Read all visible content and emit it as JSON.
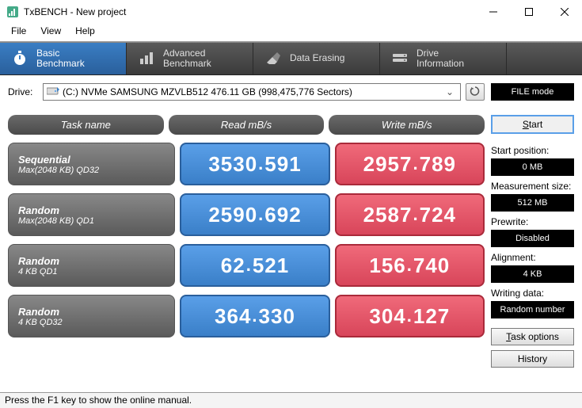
{
  "window": {
    "title": "TxBENCH - New project"
  },
  "menu": {
    "file": "File",
    "view": "View",
    "help": "Help"
  },
  "tabs": {
    "basic": "Basic\nBenchmark",
    "advanced": "Advanced\nBenchmark",
    "erasing": "Data Erasing",
    "driveinfo": "Drive\nInformation"
  },
  "drive": {
    "label": "Drive:",
    "value": "(C:) NVMe SAMSUNG MZVLB512  476.11 GB (998,475,776 Sectors)"
  },
  "headers": {
    "task": "Task name",
    "read": "Read mB/s",
    "write": "Write mB/s"
  },
  "rows": [
    {
      "title": "Sequential",
      "sub": "Max(2048 KB) QD32",
      "read": "3530.591",
      "write": "2957.789"
    },
    {
      "title": "Random",
      "sub": "Max(2048 KB) QD1",
      "read": "2590.692",
      "write": "2587.724"
    },
    {
      "title": "Random",
      "sub": "4 KB QD1",
      "read": "62.521",
      "write": "156.740"
    },
    {
      "title": "Random",
      "sub": "4 KB QD32",
      "read": "364.330",
      "write": "304.127"
    }
  ],
  "side": {
    "filemode": "FILE mode",
    "start": "Start",
    "startpos_label": "Start position:",
    "startpos_value": "0 MB",
    "meassize_label": "Measurement size:",
    "meassize_value": "512 MB",
    "prewrite_label": "Prewrite:",
    "prewrite_value": "Disabled",
    "alignment_label": "Alignment:",
    "alignment_value": "4 KB",
    "writing_label": "Writing data:",
    "writing_value": "Random number",
    "taskoptions": "Task options",
    "history": "History"
  },
  "status": "Press the F1 key to show the online manual."
}
